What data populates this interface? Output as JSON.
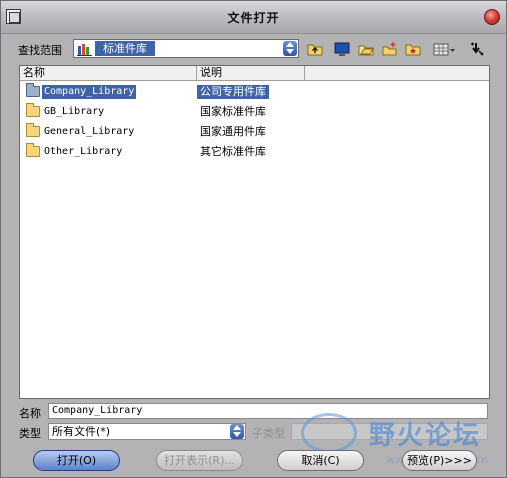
{
  "window": {
    "title": "文件打开"
  },
  "lookin": {
    "label": "查找范围",
    "value": "标准件库"
  },
  "toolbar": {
    "icons": [
      "up-folder-icon",
      "desktop-icon",
      "open-folder-icon",
      "new-folder-icon",
      "favorite-folder-icon",
      "view-menu-icon",
      "tools-icon"
    ]
  },
  "filelist": {
    "columns": [
      "名称",
      "说明"
    ],
    "rows": [
      {
        "name": "Company_Library",
        "desc": "公司专用件库"
      },
      {
        "name": "GB_Library",
        "desc": "国家标准件库"
      },
      {
        "name": "General_Library",
        "desc": "国家通用件库"
      },
      {
        "name": "Other_Library",
        "desc": "其它标准件库"
      }
    ]
  },
  "fields": {
    "name_label": "名称",
    "name_value": "Company_Library",
    "type_label": "类型",
    "type_value": "所有文件(*)",
    "subtype_label": "子类型"
  },
  "buttons": {
    "open": "打开(O)",
    "open_repr": "打开表示(R)...",
    "cancel": "取消(C)",
    "preview": "预览(P)>>>"
  },
  "watermark": {
    "text": "野火论坛",
    "url": "www.proewildfire.cn"
  },
  "colors": {
    "selection": "#3f63a7",
    "dialog_bg": "#b3b2b5"
  }
}
